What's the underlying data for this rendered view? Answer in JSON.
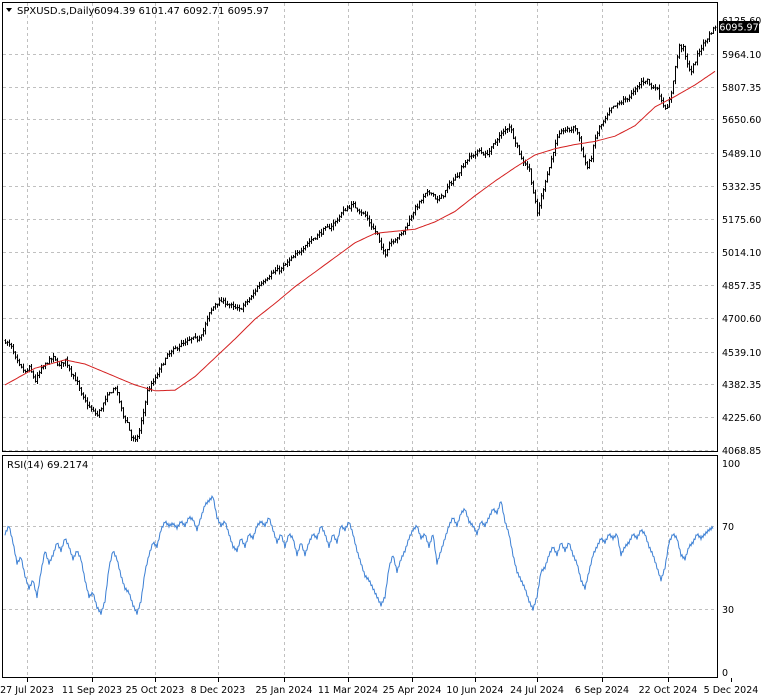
{
  "chart_data": [
    {
      "type": "candlestick",
      "title": "SPXUSD.s,Daily",
      "ohlc_label": "6094.39 6101.47 6092.71 6095.97",
      "last_price": "6095.97",
      "colors": {
        "bars": "#000000",
        "ma": "#d42020",
        "grid": "#c0c0c0",
        "last_price_box": "#000000"
      },
      "ylim": [
        4068.85,
        6125.6
      ],
      "y_ticks": [
        "6125.60",
        "5964.10",
        "5807.35",
        "5650.60",
        "5489.10",
        "5332.35",
        "5175.60",
        "5014.10",
        "4857.35",
        "4700.60",
        "4539.10",
        "4382.35",
        "4225.60",
        "4068.85"
      ],
      "x_ticks": [
        "27 Jul 2023",
        "11 Sep 2023",
        "25 Oct 2023",
        "8 Dec 2023",
        "25 Jan 2024",
        "11 Mar 2024",
        "25 Apr 2024",
        "10 Jun 2024",
        "24 Jul 2024",
        "6 Sep 2024",
        "22 Oct 2024",
        "5 Dec 2024"
      ],
      "price_anchors": [
        [
          0,
          4590
        ],
        [
          6,
          4560
        ],
        [
          10,
          4505
        ],
        [
          14,
          4470
        ],
        [
          20,
          4440
        ],
        [
          24,
          4460
        ],
        [
          30,
          4400
        ],
        [
          36,
          4455
        ],
        [
          42,
          4490
        ],
        [
          48,
          4510
        ],
        [
          54,
          4470
        ],
        [
          60,
          4500
        ],
        [
          66,
          4440
        ],
        [
          72,
          4390
        ],
        [
          76,
          4330
        ],
        [
          80,
          4300
        ],
        [
          86,
          4260
        ],
        [
          92,
          4235
        ],
        [
          98,
          4290
        ],
        [
          104,
          4340
        ],
        [
          110,
          4370
        ],
        [
          114,
          4300
        ],
        [
          118,
          4230
        ],
        [
          122,
          4200
        ],
        [
          126,
          4130
        ],
        [
          130,
          4110
        ],
        [
          134,
          4160
        ],
        [
          138,
          4250
        ],
        [
          142,
          4350
        ],
        [
          146,
          4380
        ],
        [
          150,
          4410
        ],
        [
          156,
          4470
        ],
        [
          162,
          4520
        ],
        [
          168,
          4545
        ],
        [
          174,
          4570
        ],
        [
          180,
          4580
        ],
        [
          186,
          4600
        ],
        [
          192,
          4600
        ],
        [
          198,
          4640
        ],
        [
          204,
          4720
        ],
        [
          210,
          4770
        ],
        [
          216,
          4780
        ],
        [
          222,
          4770
        ],
        [
          228,
          4750
        ],
        [
          234,
          4740
        ],
        [
          240,
          4770
        ],
        [
          246,
          4800
        ],
        [
          252,
          4850
        ],
        [
          258,
          4880
        ],
        [
          264,
          4905
        ],
        [
          270,
          4925
        ],
        [
          276,
          4935
        ],
        [
          282,
          4965
        ],
        [
          288,
          4990
        ],
        [
          294,
          5020
        ],
        [
          300,
          5050
        ],
        [
          306,
          5075
        ],
        [
          312,
          5095
        ],
        [
          318,
          5120
        ],
        [
          324,
          5135
        ],
        [
          330,
          5160
        ],
        [
          336,
          5200
        ],
        [
          342,
          5230
        ],
        [
          348,
          5240
        ],
        [
          354,
          5215
        ],
        [
          360,
          5190
        ],
        [
          366,
          5140
        ],
        [
          372,
          5100
        ],
        [
          376,
          5030
        ],
        [
          380,
          5010
        ],
        [
          384,
          5060
        ],
        [
          390,
          5080
        ],
        [
          396,
          5100
        ],
        [
          402,
          5150
        ],
        [
          408,
          5210
        ],
        [
          414,
          5250
        ],
        [
          420,
          5290
        ],
        [
          426,
          5305
        ],
        [
          432,
          5260
        ],
        [
          438,
          5290
        ],
        [
          444,
          5340
        ],
        [
          450,
          5370
        ],
        [
          456,
          5420
        ],
        [
          462,
          5460
        ],
        [
          468,
          5480
        ],
        [
          474,
          5500
        ],
        [
          480,
          5480
        ],
        [
          486,
          5510
        ],
        [
          492,
          5560
        ],
        [
          498,
          5590
        ],
        [
          504,
          5620
        ],
        [
          508,
          5570
        ],
        [
          512,
          5520
        ],
        [
          516,
          5460
        ],
        [
          520,
          5440
        ],
        [
          524,
          5410
        ],
        [
          528,
          5300
        ],
        [
          532,
          5200
        ],
        [
          536,
          5280
        ],
        [
          540,
          5360
        ],
        [
          544,
          5420
        ],
        [
          548,
          5500
        ],
        [
          552,
          5560
        ],
        [
          558,
          5600
        ],
        [
          564,
          5600
        ],
        [
          570,
          5610
        ],
        [
          574,
          5560
        ],
        [
          578,
          5470
        ],
        [
          582,
          5420
        ],
        [
          586,
          5470
        ],
        [
          590,
          5560
        ],
        [
          594,
          5610
        ],
        [
          600,
          5650
        ],
        [
          606,
          5700
        ],
        [
          612,
          5720
        ],
        [
          618,
          5740
        ],
        [
          624,
          5760
        ],
        [
          630,
          5790
        ],
        [
          636,
          5830
        ],
        [
          642,
          5840
        ],
        [
          646,
          5800
        ],
        [
          650,
          5810
        ],
        [
          654,
          5770
        ],
        [
          658,
          5720
        ],
        [
          662,
          5700
        ],
        [
          666,
          5780
        ],
        [
          670,
          5900
        ],
        [
          674,
          6000
        ],
        [
          678,
          5990
        ],
        [
          682,
          5910
        ],
        [
          686,
          5880
        ],
        [
          690,
          5930
        ],
        [
          694,
          5980
        ],
        [
          698,
          6010
        ],
        [
          702,
          6040
        ],
        [
          706,
          6070
        ],
        [
          710,
          6095
        ]
      ],
      "ma_anchors": [
        [
          0,
          4380
        ],
        [
          30,
          4460
        ],
        [
          60,
          4500
        ],
        [
          80,
          4480
        ],
        [
          110,
          4420
        ],
        [
          130,
          4380
        ],
        [
          150,
          4352
        ],
        [
          170,
          4355
        ],
        [
          190,
          4420
        ],
        [
          210,
          4510
        ],
        [
          230,
          4600
        ],
        [
          250,
          4695
        ],
        [
          270,
          4770
        ],
        [
          290,
          4850
        ],
        [
          310,
          4920
        ],
        [
          330,
          4990
        ],
        [
          350,
          5060
        ],
        [
          370,
          5105
        ],
        [
          390,
          5115
        ],
        [
          410,
          5125
        ],
        [
          430,
          5160
        ],
        [
          450,
          5210
        ],
        [
          470,
          5285
        ],
        [
          490,
          5355
        ],
        [
          510,
          5420
        ],
        [
          530,
          5480
        ],
        [
          550,
          5510
        ],
        [
          570,
          5530
        ],
        [
          590,
          5545
        ],
        [
          610,
          5570
        ],
        [
          630,
          5620
        ],
        [
          650,
          5710
        ],
        [
          670,
          5760
        ],
        [
          690,
          5815
        ],
        [
          710,
          5880
        ]
      ]
    },
    {
      "type": "line",
      "title": "RSI(14) 69.2174",
      "colors": {
        "line": "#3b7fd4",
        "grid": "#c0c0c0"
      },
      "ylim": [
        0,
        100
      ],
      "y_ticks": [
        "100",
        "70",
        "30",
        "0"
      ],
      "levels": [
        70,
        30
      ],
      "rsi_anchors": [
        [
          0,
          66
        ],
        [
          4,
          70
        ],
        [
          8,
          62
        ],
        [
          12,
          52
        ],
        [
          16,
          55
        ],
        [
          20,
          46
        ],
        [
          24,
          40
        ],
        [
          28,
          44
        ],
        [
          32,
          36
        ],
        [
          36,
          48
        ],
        [
          40,
          58
        ],
        [
          44,
          52
        ],
        [
          48,
          56
        ],
        [
          52,
          62
        ],
        [
          56,
          58
        ],
        [
          60,
          64
        ],
        [
          64,
          60
        ],
        [
          68,
          54
        ],
        [
          72,
          58
        ],
        [
          76,
          54
        ],
        [
          80,
          44
        ],
        [
          84,
          36
        ],
        [
          88,
          38
        ],
        [
          92,
          31
        ],
        [
          96,
          28
        ],
        [
          100,
          34
        ],
        [
          104,
          50
        ],
        [
          108,
          58
        ],
        [
          112,
          54
        ],
        [
          116,
          46
        ],
        [
          120,
          40
        ],
        [
          124,
          38
        ],
        [
          128,
          32
        ],
        [
          132,
          28
        ],
        [
          136,
          34
        ],
        [
          140,
          48
        ],
        [
          144,
          56
        ],
        [
          148,
          62
        ],
        [
          152,
          60
        ],
        [
          156,
          68
        ],
        [
          160,
          72
        ],
        [
          164,
          70
        ],
        [
          168,
          71
        ],
        [
          172,
          69
        ],
        [
          176,
          72
        ],
        [
          180,
          70
        ],
        [
          184,
          74
        ],
        [
          188,
          73
        ],
        [
          192,
          68
        ],
        [
          196,
          74
        ],
        [
          200,
          80
        ],
        [
          204,
          82
        ],
        [
          208,
          84
        ],
        [
          212,
          74
        ],
        [
          216,
          70
        ],
        [
          220,
          72
        ],
        [
          224,
          66
        ],
        [
          228,
          60
        ],
        [
          232,
          58
        ],
        [
          236,
          64
        ],
        [
          240,
          60
        ],
        [
          244,
          66
        ],
        [
          248,
          64
        ],
        [
          252,
          70
        ],
        [
          256,
          72
        ],
        [
          260,
          70
        ],
        [
          264,
          74
        ],
        [
          268,
          68
        ],
        [
          272,
          62
        ],
        [
          276,
          66
        ],
        [
          280,
          60
        ],
        [
          284,
          66
        ],
        [
          288,
          64
        ],
        [
          292,
          56
        ],
        [
          296,
          62
        ],
        [
          300,
          56
        ],
        [
          304,
          62
        ],
        [
          308,
          66
        ],
        [
          312,
          64
        ],
        [
          316,
          70
        ],
        [
          320,
          66
        ],
        [
          324,
          60
        ],
        [
          328,
          66
        ],
        [
          332,
          62
        ],
        [
          336,
          70
        ],
        [
          340,
          68
        ],
        [
          344,
          72
        ],
        [
          348,
          66
        ],
        [
          352,
          58
        ],
        [
          356,
          52
        ],
        [
          360,
          46
        ],
        [
          364,
          44
        ],
        [
          368,
          40
        ],
        [
          372,
          36
        ],
        [
          376,
          32
        ],
        [
          380,
          36
        ],
        [
          384,
          50
        ],
        [
          388,
          56
        ],
        [
          392,
          48
        ],
        [
          396,
          54
        ],
        [
          400,
          58
        ],
        [
          404,
          64
        ],
        [
          408,
          68
        ],
        [
          412,
          70
        ],
        [
          416,
          64
        ],
        [
          420,
          66
        ],
        [
          424,
          60
        ],
        [
          428,
          66
        ],
        [
          432,
          52
        ],
        [
          436,
          58
        ],
        [
          440,
          64
        ],
        [
          444,
          70
        ],
        [
          448,
          74
        ],
        [
          452,
          70
        ],
        [
          456,
          76
        ],
        [
          460,
          78
        ],
        [
          464,
          72
        ],
        [
          468,
          70
        ],
        [
          472,
          66
        ],
        [
          476,
          72
        ],
        [
          480,
          70
        ],
        [
          484,
          74
        ],
        [
          488,
          78
        ],
        [
          492,
          76
        ],
        [
          496,
          82
        ],
        [
          500,
          72
        ],
        [
          504,
          66
        ],
        [
          508,
          56
        ],
        [
          512,
          48
        ],
        [
          516,
          44
        ],
        [
          520,
          40
        ],
        [
          524,
          34
        ],
        [
          528,
          30
        ],
        [
          532,
          36
        ],
        [
          536,
          48
        ],
        [
          540,
          50
        ],
        [
          544,
          56
        ],
        [
          548,
          60
        ],
        [
          552,
          56
        ],
        [
          556,
          62
        ],
        [
          560,
          58
        ],
        [
          564,
          62
        ],
        [
          568,
          56
        ],
        [
          572,
          52
        ],
        [
          576,
          44
        ],
        [
          580,
          40
        ],
        [
          584,
          48
        ],
        [
          588,
          56
        ],
        [
          592,
          60
        ],
        [
          596,
          64
        ],
        [
          600,
          62
        ],
        [
          604,
          66
        ],
        [
          608,
          64
        ],
        [
          612,
          66
        ],
        [
          616,
          56
        ],
        [
          620,
          60
        ],
        [
          624,
          62
        ],
        [
          628,
          66
        ],
        [
          632,
          64
        ],
        [
          636,
          68
        ],
        [
          640,
          66
        ],
        [
          644,
          60
        ],
        [
          648,
          56
        ],
        [
          652,
          50
        ],
        [
          656,
          44
        ],
        [
          660,
          50
        ],
        [
          664,
          62
        ],
        [
          668,
          66
        ],
        [
          672,
          64
        ],
        [
          676,
          56
        ],
        [
          680,
          54
        ],
        [
          684,
          60
        ],
        [
          688,
          62
        ],
        [
          692,
          66
        ],
        [
          696,
          64
        ],
        [
          700,
          66
        ],
        [
          704,
          68
        ],
        [
          708,
          69.2
        ]
      ]
    }
  ]
}
